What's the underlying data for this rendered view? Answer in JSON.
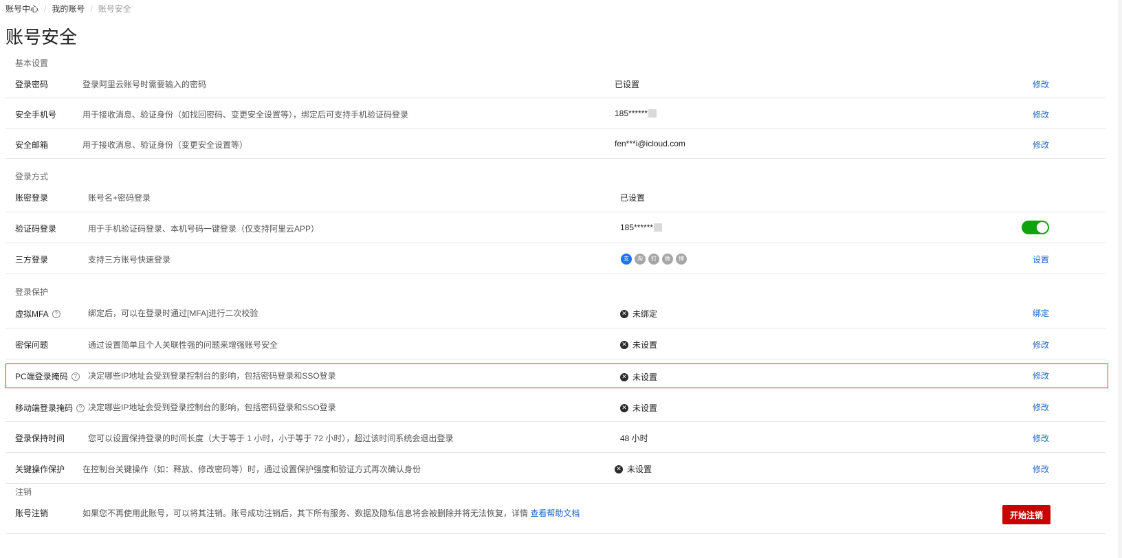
{
  "breadcrumb": [
    "账号中心",
    "我的账号",
    "账号安全"
  ],
  "page_title": "账号安全",
  "sections": {
    "basic": "基本设置",
    "login_method": "登录方式",
    "login_protection": "登录保护",
    "cancel": "注销"
  },
  "rows": {
    "password": {
      "name": "登录密码",
      "desc": "登录阿里云账号时需要输入的密码",
      "status": "已设置",
      "action": "修改"
    },
    "phone": {
      "name": "安全手机号",
      "desc": "用于接收消息、验证身份（如找回密码、变更安全设置等），绑定后可支持手机验证码登录",
      "status": "185******",
      "action": "修改"
    },
    "email": {
      "name": "安全邮箱",
      "desc": "用于接收消息、验证身份（变更安全设置等）",
      "status": "fen***i@icloud.com",
      "action": "修改"
    },
    "account_login": {
      "name": "账密登录",
      "desc": "账号名+密码登录",
      "status": "已设置"
    },
    "code_login": {
      "name": "验证码登录",
      "desc": "用于手机验证码登录、本机号码一键登录（仅支持阿里云APP）",
      "status": "185******",
      "toggle_on": true
    },
    "third_login": {
      "name": "三方登录",
      "desc": "支持三方账号快速登录",
      "action": "设置",
      "providers": [
        {
          "icon": "alipay-icon",
          "glyph": "支",
          "color": "#1677ff"
        },
        {
          "icon": "taobao-icon",
          "glyph": "淘",
          "color": "#a6a6a6"
        },
        {
          "icon": "dingtalk-icon",
          "glyph": "钉",
          "color": "#a6a6a6"
        },
        {
          "icon": "wechat-icon",
          "glyph": "微",
          "color": "#a6a6a6"
        },
        {
          "icon": "weibo-icon",
          "glyph": "博",
          "color": "#a6a6a6"
        }
      ]
    },
    "mfa": {
      "name": "虚拟MFA",
      "desc": "绑定后，可以在登录时通过[MFA]进行二次校验",
      "status": "未绑定",
      "action": "绑定"
    },
    "security_question": {
      "name": "密保问题",
      "desc": "通过设置简单且个人关联性强的问题来增强账号安全",
      "status": "未设置",
      "action": "修改"
    },
    "pc_mask": {
      "name": "PC端登录掩码",
      "desc": "决定哪些IP地址会受到登录控制台的影响，包括密码登录和SSO登录",
      "status": "未设置",
      "action": "修改"
    },
    "mobile_mask": {
      "name": "移动端登录掩码",
      "desc": "决定哪些IP地址会受到登录控制台的影响，包括密码登录和SSO登录",
      "status": "未设置",
      "action": "修改"
    },
    "session": {
      "name": "登录保持时间",
      "desc": "您可以设置保持登录的时间长度（大于等于 1 小时，小于等于 72 小时），超过该时间系统会退出登录",
      "status": "48 小时",
      "action": "修改"
    },
    "key_op": {
      "name": "关键操作保护",
      "desc": "在控制台关键操作（如：释放、修改密码等）时，通过设置保护强度和验证方式再次确认身份",
      "status": "未设置",
      "action": "修改"
    },
    "cancel_account": {
      "name": "账号注销",
      "desc": "如果您不再使用此账号，可以将其注销。账号成功注销后，其下所有服务、数据及隐私信息将会被删除并将无法恢复，详情",
      "link": "查看帮助文档",
      "button": "开始注销"
    }
  },
  "colors": {
    "link": "#1a66c8",
    "toggle": "#10a20f",
    "danger": "#c80000",
    "highlight_border": "#e0282e"
  }
}
